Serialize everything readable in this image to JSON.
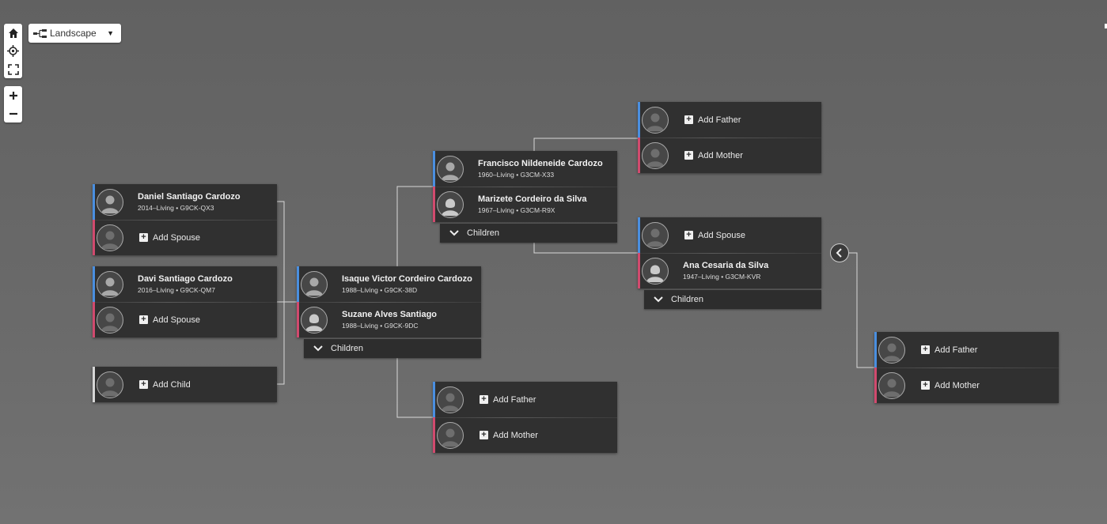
{
  "view_selector": {
    "label": "Landscape"
  },
  "controls": {
    "home": "home-icon",
    "recenter": "target-icon",
    "fullscreen": "fullscreen-icon",
    "zoom_in": "+",
    "zoom_out": "−"
  },
  "actions": {
    "add_spouse": "Add Spouse",
    "add_child": "Add Child",
    "add_father": "Add Father",
    "add_mother": "Add Mother",
    "children": "Children"
  },
  "people": {
    "daniel": {
      "name": "Daniel Santiago Cardozo",
      "meta": "2014–Living • G9CK-QX3"
    },
    "davi": {
      "name": "Davi Santiago Cardozo",
      "meta": "2016–Living • G9CK-QM7"
    },
    "isaque": {
      "name": "Isaque Victor Cordeiro Cardozo",
      "meta": "1988–Living • G9CK-38D"
    },
    "suzane": {
      "name": "Suzane Alves Santiago",
      "meta": "1988–Living • G9CK-9DC"
    },
    "francisco": {
      "name": "Francisco Nildeneide Cardozo",
      "meta": "1960–Living • G3CM-X33"
    },
    "marizete": {
      "name": "Marizete Cordeiro da Silva",
      "meta": "1967–Living • G3CM-R9X"
    },
    "ana": {
      "name": "Ana Cesaria da Silva",
      "meta": "1947–Living • G3CM-KVR"
    }
  },
  "colors": {
    "male": "#4a8fe0",
    "female": "#d14a6e",
    "card": "#303030",
    "background": "#666666"
  }
}
